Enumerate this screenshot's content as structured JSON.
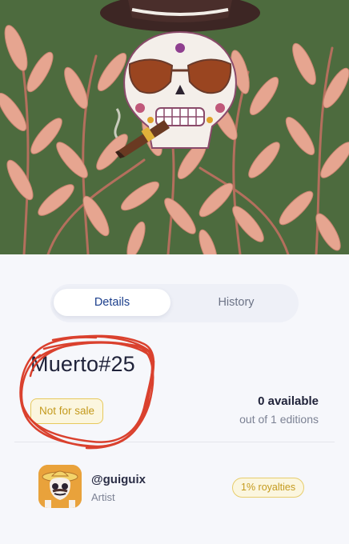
{
  "artwork": {
    "name": "Muerto#25",
    "status_badge": "Not for sale"
  },
  "tabs": [
    {
      "label": "Details",
      "active": true
    },
    {
      "label": "History",
      "active": false
    }
  ],
  "availability": {
    "available": "0 available",
    "editions": "out of 1 editions"
  },
  "artist": {
    "handle": "@guiguix",
    "role": "Artist",
    "royalties": "1% royalties"
  },
  "colors": {
    "hero_background": "#4d6b3e",
    "leaf": "#e6a590",
    "accent_blue": "#1c3f8c",
    "badge_gold": "#c49a1d",
    "annotation_red": "#d8321d"
  },
  "icons": {
    "hero": "sugar-skull-artwork",
    "avatar": "sugar-skull-avatar"
  }
}
